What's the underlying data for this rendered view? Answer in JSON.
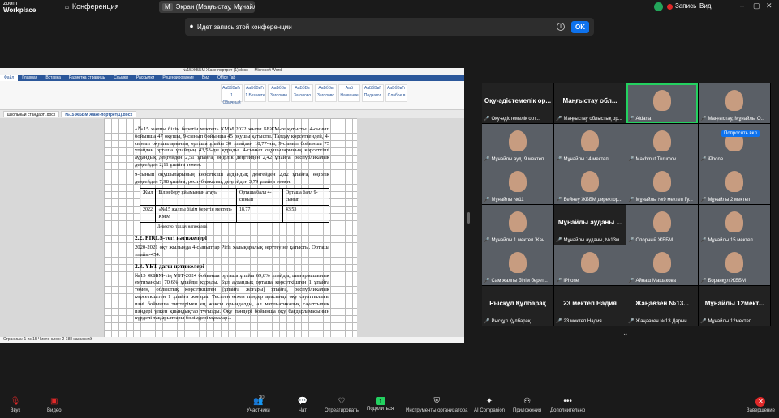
{
  "topbar": {
    "brand_line1": "zoom",
    "brand_line2": "Workplace",
    "conference_tab": "Конференция",
    "screen_avatar": "M",
    "screen_tab": "Экран (Маңғыстау, Мұнайлы О",
    "record_label": "Запись",
    "view_label": "Вид"
  },
  "banner": {
    "text": "Идет запись этой конференции",
    "ok_label": "OK"
  },
  "word": {
    "title": "№15 ЖББМ Жаке-портрет (1).docx — Microsoft Word",
    "tabs": [
      "Файл",
      "Главная",
      "Вставка",
      "Разметка страницы",
      "Ссылки",
      "Рассылки",
      "Рецензирование",
      "Вид",
      "Office Tab"
    ],
    "styles": [
      "AaБбВвГг 1 Обычный",
      "AaБбВвГг 1 Без инте",
      "AaБбВв Заголово",
      "AaБбВв Заголово",
      "AaБбВв Заголово",
      "AaБ Название",
      "AaБбВвГ Подзагол",
      "AaБбВвГг Слабое в"
    ],
    "doc_tabs": [
      "школьный стандарт .docx",
      "№15 ЖББМ Жаке-портрет(1).docx"
    ],
    "status": "Страница: 1 из 15   Число слов: 2 188   казахский",
    "body": {
      "p1": "«№15 жалпы білім беретін мектеп» КММ 2022 жылы ББЖМ-ге қатысты. 4-сынып бойынша 47 оқушы, 9-сынып бойынша 45 оқушы қатысты. Талдау көрсеткендей, 4-сынып оқушыларының орташа ұпайы 30 ұпайдан 18,77-ны, 9-сынып бойынша 75 ұпайдан орташа ұпайдың 43,53-ды құрады. 4-сынып оқушыларының көрсеткіші аудандық деңгейден 2,51 ұпайға, өңірлік деңгейден 2,42 ұпайға, республикалық деңгейден 2,11 ұпайға төмен.",
      "p2": "9-сынып оқушыларының көрсеткіші аудандық деңгейден 2,82 ұпайға, өңірлік деңгейден 7,98 ұпайға, республикалық деңгейден 3,79 ұпайға төмен.",
      "table": {
        "headers": [
          "Жыл",
          "Білім беру ұйымының атауы",
          "Орташа балл 4-сынып",
          "Орташа балл 9-сынып"
        ],
        "row": [
          "2022",
          "«№15 жалпы білім беретін мектеп» КММ",
          "18,77",
          "43,53"
        ]
      },
      "caption": "Деректер: талдау нәтижелері",
      "h1": "2.2. PIRLS-тегі нәтижелері",
      "p3": "2020-2021 оқу жылында 4-сыныптар Pirls халықаралық зерттеуіне қатысты. Орташа ұпайы-454.",
      "h2": "2.3. ҰБТ дағы нәтижелері",
      "p4": "№15 ЖББМ-тің ҰБТ-2024 бойынша орташа ұпайы 69,8% ұпайды, шығармашылық емтихансыз 70,6% ұпайды құрады. Бұл аудандық орташа көрсеткіштен 1 ұпайға төмен, облыстық көрсеткіштен [ұпайға жоғары] ұпайға, республикалық көрсеткіштен 1 ұпайға жоғары. Тесттен өткен пәндер арасында оқу сауаттылығы пәні бойынша типтерімен ең жақсы орындалды, ал математикалық сауаттылық пәндері үлкен қиындықтар туғызды. Оқу пәндері бойынша оқу бағдарламасының күрделі тақырыптары бөлімдері мұғалар..."
    }
  },
  "gallery": [
    {
      "type": "text",
      "big": "Оқу-әдістемелік ор...",
      "name": "Оқу-әдістемелік орт..."
    },
    {
      "type": "text",
      "big": "Маңғыстау обл...",
      "name": "Маңғыстау облыстық ор..."
    },
    {
      "type": "cam",
      "name": "Aidana",
      "active": true
    },
    {
      "type": "cam",
      "name": "Маңғыстау, Мұнайлы О..."
    },
    {
      "type": "cam",
      "name": "Мұнайлы ауд. 9 мектеп..."
    },
    {
      "type": "cam",
      "name": "Мұнайлы 14 мектеп"
    },
    {
      "type": "cam",
      "name": "Makhmut Turumov"
    },
    {
      "type": "cam",
      "name": "iPhone",
      "popup": "Попросить вкл"
    },
    {
      "type": "cam",
      "name": "Мұнайлы №11"
    },
    {
      "type": "cam",
      "name": "Бейнеу ЖББМ директор..."
    },
    {
      "type": "cam",
      "name": "Мұнайлы №9 мектеп Гу..."
    },
    {
      "type": "cam",
      "name": "Мұнайлы 2 мектеп"
    },
    {
      "type": "cam",
      "name": "Мұнайлы 1 мектеп Жан..."
    },
    {
      "type": "text",
      "big": "Мұнайлы ауданы ...",
      "name": "Мұнайлы ауданы, №13м..."
    },
    {
      "type": "cam",
      "name": "Опорный ЖББМ"
    },
    {
      "type": "cam",
      "name": "Мұнайлы 15 мектеп"
    },
    {
      "type": "cam",
      "name": "Сам жалпы білім берет..."
    },
    {
      "type": "cam",
      "name": "iPhone"
    },
    {
      "type": "cam",
      "name": "Айнаш Машакова"
    },
    {
      "type": "cam",
      "name": "Боранқұл ЖББМ"
    },
    {
      "type": "text",
      "big": "Рысқұл Құлбарақ",
      "name": "Рысқұл Құлбарақ"
    },
    {
      "type": "text",
      "big": "23 мектеп Надия",
      "name": "23 мектеп Надия"
    },
    {
      "type": "text",
      "big": "Жаңаөзен №13...",
      "name": "Жаңаөзен №13 Дарын"
    },
    {
      "type": "text",
      "big": "Мұнайлы 12мект...",
      "name": "Мұнайлы 12мектеп"
    }
  ],
  "toolbar": {
    "audio": "Звук",
    "video": "Видео",
    "participants": "Участники",
    "participants_count": "30",
    "chat": "Чат",
    "react": "Отреагировать",
    "share": "Поделиться",
    "host_tools": "Инструменты организатора",
    "ai": "AI Companion",
    "apps": "Приложения",
    "more": "Дополнительно",
    "end": "Завершение"
  }
}
